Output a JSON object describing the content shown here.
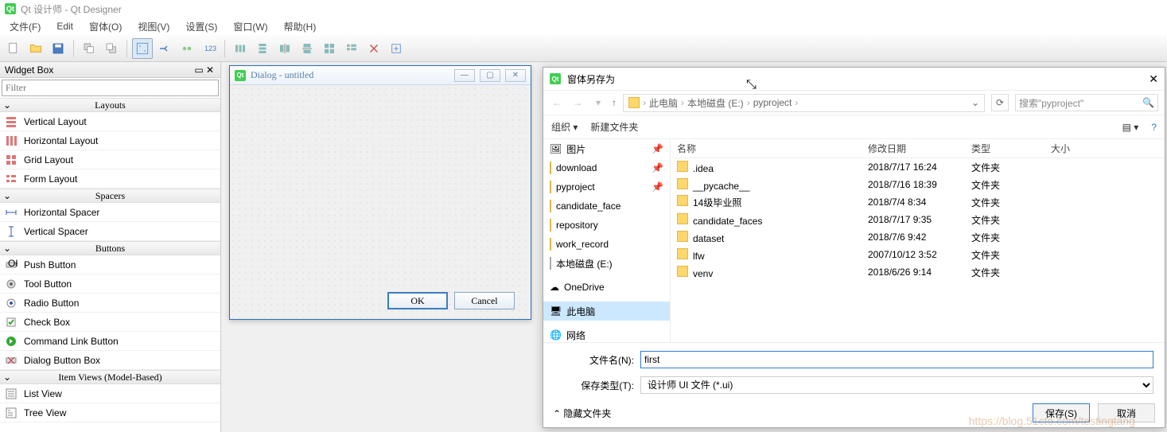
{
  "app": {
    "title": "Qt 设计师 - Qt Designer"
  },
  "menu": [
    "文件(F)",
    "Edit",
    "窗体(O)",
    "视图(V)",
    "设置(S)",
    "窗口(W)",
    "帮助(H)"
  ],
  "widgetbox": {
    "title": "Widget Box",
    "filter_placeholder": "Filter",
    "sections": [
      {
        "label": "Layouts",
        "items": [
          "Vertical Layout",
          "Horizontal Layout",
          "Grid Layout",
          "Form Layout"
        ]
      },
      {
        "label": "Spacers",
        "items": [
          "Horizontal Spacer",
          "Vertical Spacer"
        ]
      },
      {
        "label": "Buttons",
        "items": [
          "Push Button",
          "Tool Button",
          "Radio Button",
          "Check Box",
          "Command Link Button",
          "Dialog Button Box"
        ]
      },
      {
        "label": "Item Views (Model-Based)",
        "items": [
          "List View",
          "Tree View"
        ]
      }
    ]
  },
  "dialog": {
    "title": "Dialog - untitled",
    "ok": "OK",
    "cancel": "Cancel"
  },
  "save": {
    "title": "窗体另存为",
    "breadcrumb": [
      "此电脑",
      "本地磁盘 (E:)",
      "pyproject"
    ],
    "search_placeholder": "搜索\"pyproject\"",
    "organize": "组织",
    "newfolder": "新建文件夹",
    "tree": [
      {
        "icon": "pics",
        "label": "图片",
        "pin": true
      },
      {
        "icon": "folder",
        "label": "download",
        "pin": true
      },
      {
        "icon": "folder",
        "label": "pyproject",
        "pin": true
      },
      {
        "icon": "folder",
        "label": "candidate_face"
      },
      {
        "icon": "folder",
        "label": "repository"
      },
      {
        "icon": "folder",
        "label": "work_record"
      },
      {
        "icon": "drive",
        "label": "本地磁盘 (E:)"
      },
      {
        "icon": "cloud",
        "label": "OneDrive",
        "space_before": true
      },
      {
        "icon": "pc",
        "label": "此电脑",
        "selected": true,
        "space_before": true
      },
      {
        "icon": "net",
        "label": "网络",
        "space_before": true
      }
    ],
    "columns": {
      "name": "名称",
      "date": "修改日期",
      "type": "类型",
      "size": "大小"
    },
    "files": [
      {
        "name": ".idea",
        "date": "2018/7/17 16:24",
        "type": "文件夹"
      },
      {
        "name": "__pycache__",
        "date": "2018/7/16 18:39",
        "type": "文件夹"
      },
      {
        "name": "14级毕业照",
        "date": "2018/7/4 8:34",
        "type": "文件夹"
      },
      {
        "name": "candidate_faces",
        "date": "2018/7/17 9:35",
        "type": "文件夹"
      },
      {
        "name": "dataset",
        "date": "2018/7/6 9:42",
        "type": "文件夹"
      },
      {
        "name": "lfw",
        "date": "2007/10/12 3:52",
        "type": "文件夹"
      },
      {
        "name": "venv",
        "date": "2018/6/26 9:14",
        "type": "文件夹"
      }
    ],
    "filename_label": "文件名(N):",
    "filename_value": "first",
    "savetype_label": "保存类型(T):",
    "savetype_value": "设计师 UI 文件 (*.ui)",
    "hidefolders": "隐藏文件夹",
    "save_btn": "保存(S)",
    "cancel_btn": "取消"
  },
  "watermark": "https://blog.51cto.com/testingtang"
}
